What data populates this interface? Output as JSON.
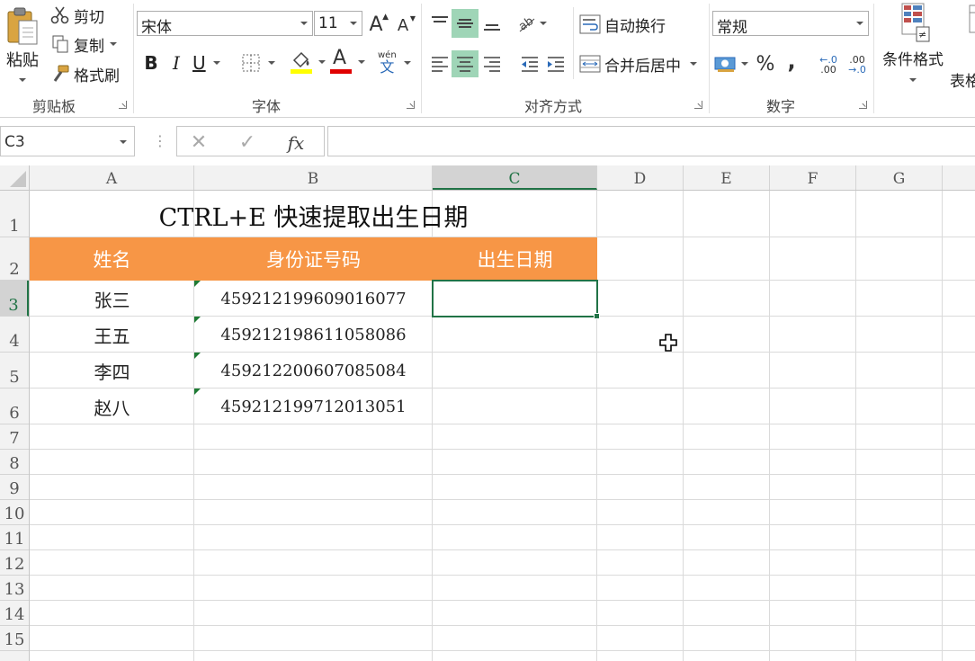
{
  "ribbon": {
    "clipboard": {
      "paste_label": "粘贴",
      "cut_label": "剪切",
      "copy_label": "复制",
      "format_painter_label": "格式刷",
      "group_label": "剪贴板"
    },
    "font": {
      "font_name": "宋体",
      "font_size": "11",
      "group_label": "字体",
      "bold": "B",
      "italic": "I",
      "underline": "U",
      "phonetic_top": "wén",
      "phonetic_bottom": "文",
      "increase_size_glyph": "A",
      "decrease_size_glyph": "A",
      "font_color_glyph": "A",
      "fill_color": "#ffff00",
      "font_color": "#e00000"
    },
    "alignment": {
      "wrap_text_label": "自动换行",
      "merge_center_label": "合并后居中",
      "group_label": "对齐方式"
    },
    "number": {
      "format_value": "常规",
      "percent_glyph": "%",
      "comma_glyph": ",",
      "inc_decimal_top": "←.0",
      "inc_decimal_bottom": ".00",
      "dec_decimal_top": ".00",
      "dec_decimal_bottom": "→.0",
      "group_label": "数字"
    },
    "styles": {
      "conditional_format_label": "条件格式",
      "table_format_label_partial": "表格"
    }
  },
  "formula_bar": {
    "name_box_value": "C3",
    "fx_label": "fx",
    "formula_value": ""
  },
  "sheet": {
    "columns": [
      "A",
      "B",
      "C",
      "D",
      "E",
      "F",
      "G"
    ],
    "active_column": "C",
    "rows": [
      "1",
      "2",
      "3",
      "4",
      "5",
      "6",
      "7",
      "8",
      "9",
      "10",
      "11",
      "12",
      "13",
      "14",
      "15"
    ],
    "active_row": "3",
    "title": "CTRL+E 快速提取出生日期",
    "headers": {
      "name": "姓名",
      "id": "身份证号码",
      "birth": "出生日期"
    },
    "header_color": "#f79646",
    "records": [
      {
        "name": "张三",
        "id": "459212199609016077",
        "birth": ""
      },
      {
        "name": "王五",
        "id": "459212198611058086",
        "birth": ""
      },
      {
        "name": "李四",
        "id": "459212200607085084",
        "birth": ""
      },
      {
        "name": "赵八",
        "id": "459212199712013051",
        "birth": ""
      }
    ]
  },
  "colors": {
    "accent_green": "#217346",
    "error_triangle": "#1e7b34"
  }
}
